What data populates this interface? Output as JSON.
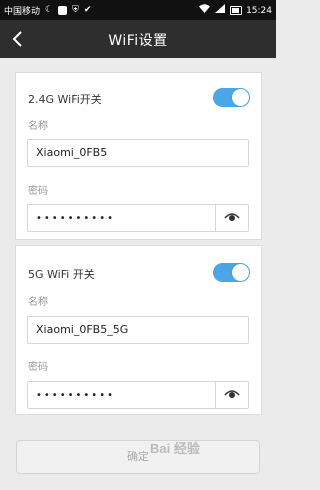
{
  "status_bar": {
    "carrier": "中国移动",
    "time": "15:24",
    "icons": [
      "moon-icon",
      "image-icon",
      "shield-icon",
      "check-circle-icon",
      "wifi-icon",
      "signal-icon",
      "battery-icon"
    ]
  },
  "header": {
    "title": "WiFi设置",
    "back_icon": "chevron-left-icon"
  },
  "wifi_24g": {
    "switch_label": "2.4G WiFi开关",
    "enabled": true,
    "name_label": "名称",
    "name_value": "Xiaomi_0FB5",
    "password_label": "密码",
    "password_value": "••••••••••"
  },
  "wifi_5g": {
    "switch_label": "5G WiFi 开关",
    "enabled": true,
    "name_label": "名称",
    "name_value": "Xiaomi_0FB5_5G",
    "password_label": "密码",
    "password_value": "••••••••••"
  },
  "confirm_button": {
    "label": "确定"
  },
  "watermark": "Bai 经验",
  "colors": {
    "accent": "#4aa6e6",
    "titlebar": "#2e2e2e",
    "background": "#ebebeb"
  }
}
